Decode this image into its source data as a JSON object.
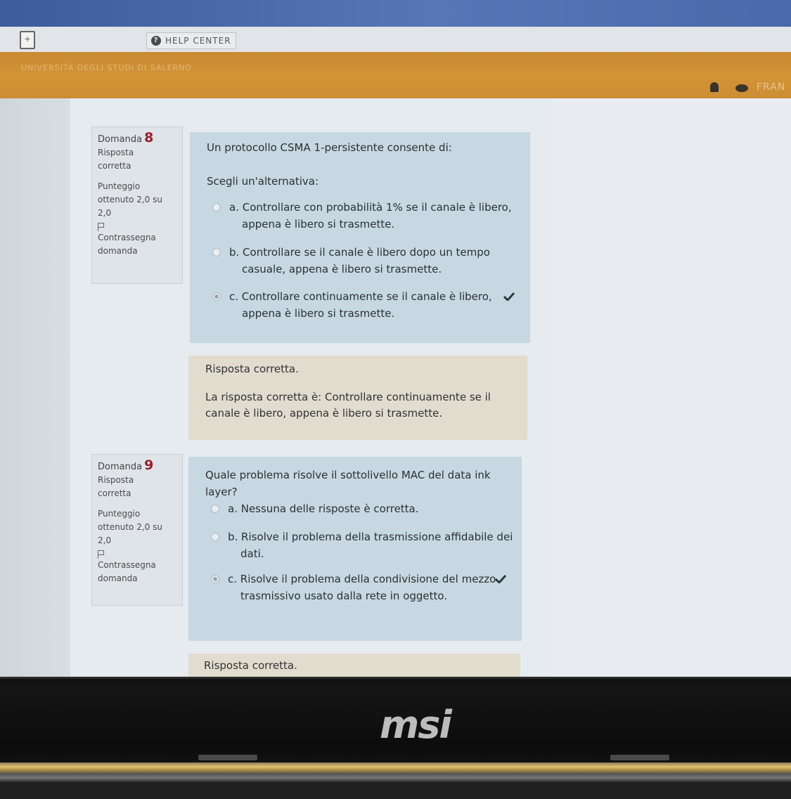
{
  "header": {
    "help_center_label": "HELP CENTER",
    "university_name": "UNIVERSITÀ DEGLI STUDI DI SALERNO",
    "user_name": "FRAN"
  },
  "questions": [
    {
      "label": "Domanda",
      "number": "8",
      "status_line1": "Risposta",
      "status_line2": "corretta",
      "score_line1": "Punteggio",
      "score_line2": "ottenuto 2,0 su",
      "score_line3": "2,0",
      "flag_line1": "Contrassegna",
      "flag_line2": "domanda",
      "prompt": "Un protocollo CSMA 1-persistente consente di:",
      "choose_label": "Scegli un'alternativa:",
      "answers": [
        {
          "line1": "a. Controllare con probabilità 1% se il canale è libero,",
          "line2": "appena è libero si trasmette.",
          "selected": false
        },
        {
          "line1": "b. Controllare se il canale è libero dopo un tempo",
          "line2": "casuale, appena è libero si trasmette.",
          "selected": false
        },
        {
          "line1": "c. Controllare continuamente se il canale è libero,",
          "line2": "appena è libero si trasmette.",
          "selected": true
        }
      ],
      "feedback_title": "Risposta corretta.",
      "feedback_line1": "La risposta corretta è: Controllare continuamente se il",
      "feedback_line2": "canale è libero, appena è libero si trasmette."
    },
    {
      "label": "Domanda",
      "number": "9",
      "status_line1": "Risposta",
      "status_line2": "corretta",
      "score_line1": "Punteggio",
      "score_line2": "ottenuto 2,0 su",
      "score_line3": "2,0",
      "flag_line1": "Contrassegna",
      "flag_line2": "domanda",
      "prompt": "Quale problema risolve il sottolivello MAC del data ink layer?",
      "answers": [
        {
          "line1": "a. Nessuna delle risposte è corretta.",
          "line2": "",
          "selected": false
        },
        {
          "line1": "b. Risolve il problema della trasmissione affidabile dei",
          "line2": "dati.",
          "selected": false
        },
        {
          "line1": "c. Risolve il problema della condivisione del mezzo",
          "line2": "trasmissivo usato dalla rete in oggetto.",
          "selected": true
        }
      ],
      "feedback_title": "Risposta corretta."
    }
  ],
  "bezel": {
    "brand": "msi"
  }
}
